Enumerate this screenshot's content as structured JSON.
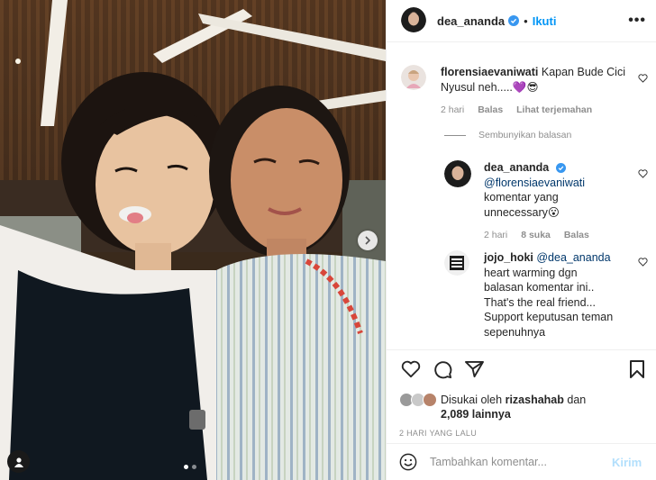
{
  "post": {
    "author": "dea_ananda",
    "separator": "•",
    "follow_label": "Ikuti",
    "more_icon": "more-horizontal-icon"
  },
  "comments": [
    {
      "username": "florensiaevaniwati",
      "text": "Kapan Bude Cici Nyusul neh.....💜😎",
      "time": "2 hari",
      "reply_label": "Balas",
      "translate_label": "Lihat terjemahan"
    }
  ],
  "hide_replies_label": "Sembunyikan balasan",
  "replies": [
    {
      "username": "dea_ananda",
      "mention": "@florensiaevaniwati",
      "text": "komentar yang unnecessary😮",
      "time": "2 hari",
      "likes": "8 suka",
      "reply_label": "Balas"
    },
    {
      "username": "jojo_hoki",
      "mention": "@dea_ananda",
      "text": "heart warming dgn balasan komentar ini.. That's the real friend... Support keputusan teman sepenuhnya"
    }
  ],
  "likes": {
    "prefix": "Disukai oleh",
    "user": "rizashahab",
    "conj": "dan",
    "count": "2,089 lainnya"
  },
  "date": "2 HARI YANG LALU",
  "add_comment": {
    "placeholder": "Tambahkan komentar...",
    "post_label": "Kirim"
  },
  "colors": {
    "accent": "#0095f6",
    "verified": "#3897f0",
    "muted": "#8e8e8e",
    "post_disabled": "#b2dffc"
  }
}
